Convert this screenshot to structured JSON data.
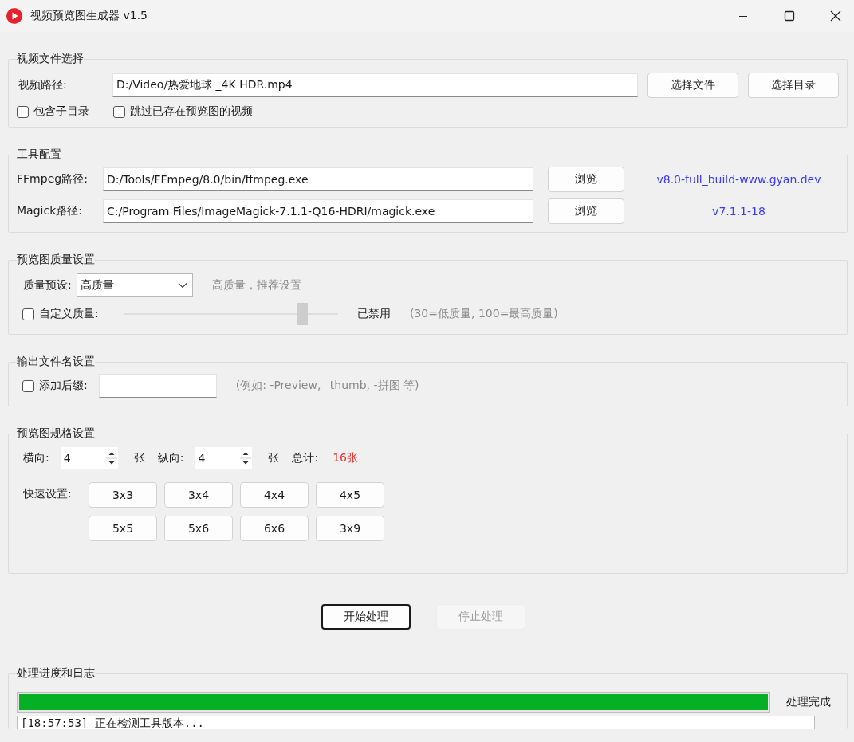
{
  "window": {
    "title": "视频预览图生成器 v1.5"
  },
  "video_section": {
    "title": "视频文件选择",
    "path_label": "视频路径:",
    "path_value": "D:/Video/热爱地球 _4K HDR.mp4",
    "buttons": [
      "选择文件",
      "选择目录"
    ],
    "options": [
      {
        "label": "包含子目录",
        "checked": false
      },
      {
        "label": "跳过已存在预览图的视频",
        "checked": false
      }
    ]
  },
  "tools_section": {
    "title": "工具配置",
    "tools": [
      {
        "label": "FFmpeg路径:",
        "value": "D:/Tools/FFmpeg/8.0/bin/ffmpeg.exe",
        "button": "浏览",
        "version": "v8.0-full_build-www.gyan.dev"
      },
      {
        "label": "Magick路径:",
        "value": "C:/Program Files/ImageMagick-7.1.1-Q16-HDRI/magick.exe",
        "button": "浏览",
        "version": "v7.1.1-18"
      }
    ]
  },
  "quality_section": {
    "title": "预览图质量设置",
    "preset_label": "质量预设:",
    "preset_value": "高质量",
    "preset_hint": "高质量，推荐设置",
    "custom": {
      "label": "自定义质量:",
      "checked": false,
      "level": 0.83,
      "disabled": true,
      "status": "已禁用",
      "hint": "(30=低质量, 100=最高质量)"
    }
  },
  "output_section": {
    "title": "输出文件名设置",
    "suffix": {
      "label": "添加后缀:",
      "checked": false
    },
    "hint": "(例如: -Preview, _thumb, -拼图 等)"
  },
  "grid_section": {
    "title": "预览图规格设置",
    "horizontal": {
      "label": "横向:",
      "value": "4",
      "unit": "张"
    },
    "vertical": {
      "label": "纵向:",
      "value": "4",
      "unit": "张"
    },
    "total_label": "总计:",
    "total_value": "16张",
    "quick_label": "快速设置:",
    "presets": [
      "3x3",
      "3x4",
      "4x4",
      "4x5",
      "5x5",
      "5x6",
      "6x6",
      "3x9"
    ]
  },
  "actions": [
    {
      "label": "开始处理",
      "disabled": false,
      "focused": true
    },
    {
      "label": "停止处理",
      "disabled": true,
      "focused": false
    }
  ],
  "progress_section": {
    "title": "处理进度和日志",
    "level": 1,
    "status": "处理完成",
    "log": [
      "[18:57:53] 正在检测工具版本..."
    ]
  }
}
